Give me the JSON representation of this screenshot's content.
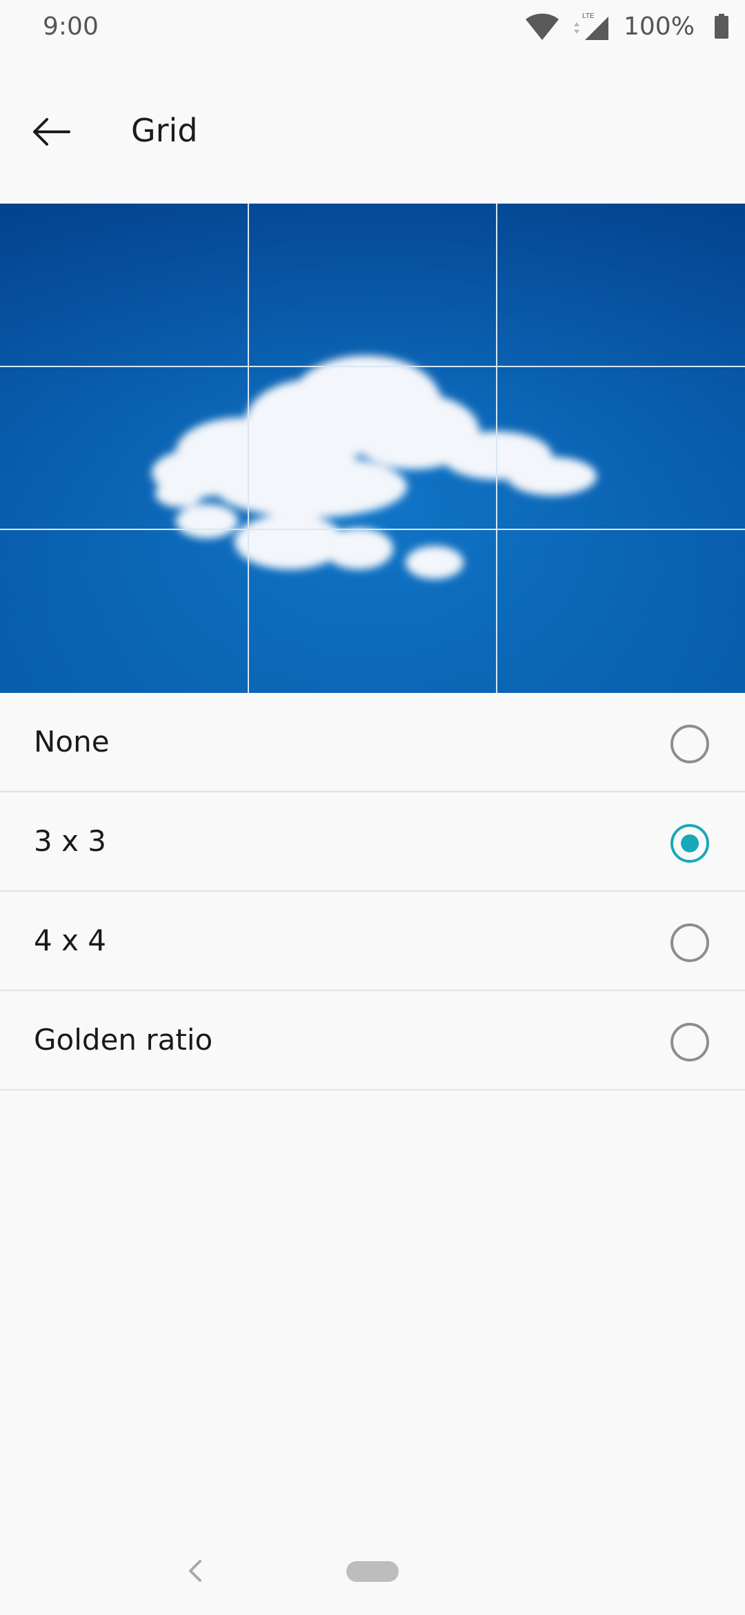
{
  "status_bar": {
    "time": "9:00",
    "network_label": "LTE",
    "battery_percent": "100%",
    "icons": [
      "wifi-icon",
      "cell-signal-icon",
      "battery-icon"
    ]
  },
  "toolbar": {
    "title": "Grid",
    "back_icon": "arrow-left-icon"
  },
  "preview": {
    "subject": "cloud-in-blue-sky",
    "grid_overlay": "3 x 3"
  },
  "options": [
    {
      "label": "None",
      "selected": false
    },
    {
      "label": "3 x 3",
      "selected": true
    },
    {
      "label": "4 x 4",
      "selected": false
    },
    {
      "label": "Golden ratio",
      "selected": false
    }
  ],
  "colors": {
    "accent": "#17a8b9",
    "background": "#f9f9f9",
    "sky": "#0a62b6"
  },
  "nav_bar": {
    "back_icon": "chevron-left-icon",
    "home_icon": "home-pill-icon"
  }
}
